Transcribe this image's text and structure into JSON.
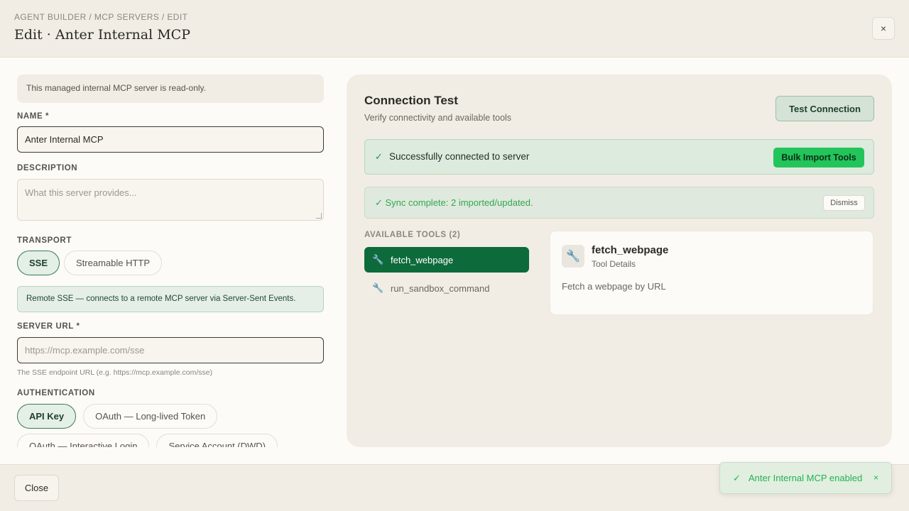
{
  "header": {
    "breadcrumb": "AGENT BUILDER / MCP SERVERS / EDIT",
    "title": "Edit · Anter Internal MCP",
    "close_icon": "×"
  },
  "form": {
    "readonly_note": "This managed internal MCP server is read-only.",
    "name_label": "NAME *",
    "name_value": "Anter Internal MCP",
    "description_label": "DESCRIPTION",
    "description_placeholder": "What this server provides...",
    "transport_label": "TRANSPORT",
    "transport_options": [
      "SSE",
      "Streamable HTTP"
    ],
    "transport_selected": "SSE",
    "transport_info": "Remote SSE — connects to a remote MCP server via Server-Sent Events.",
    "server_url_label": "SERVER URL *",
    "server_url_placeholder": "https://mcp.example.com/sse",
    "server_url_hint": "The SSE endpoint URL (e.g. https://mcp.example.com/sse)",
    "auth_label": "AUTHENTICATION",
    "auth_options": [
      "API Key",
      "OAuth — Long-lived Token",
      "OAuth — Interactive Login",
      "Service Account (DWD)"
    ],
    "auth_selected": "API Key"
  },
  "connection": {
    "title": "Connection Test",
    "subtitle": "Verify connectivity and available tools",
    "test_button": "Test Connection",
    "success_text": "Successfully connected to server",
    "bulk_import_button": "Bulk Import Tools",
    "sync_text": "✓ Sync complete: 2 imported/updated.",
    "dismiss_button": "Dismiss",
    "tools_label": "AVAILABLE TOOLS (2)",
    "tools": [
      "fetch_webpage",
      "run_sandbox_command"
    ],
    "selected_tool": "fetch_webpage",
    "detail": {
      "name": "fetch_webpage",
      "subtitle": "Tool Details",
      "description": "Fetch a webpage by URL"
    }
  },
  "footer": {
    "close_button": "Close"
  },
  "toast": {
    "text": "Anter Internal MCP enabled",
    "close_icon": "×"
  },
  "colors": {
    "accent_green": "#0d6b3b",
    "success_green": "#23c45a",
    "background": "#f1ede4"
  },
  "icons": {
    "tool": "wrench-icon",
    "check": "check-icon"
  }
}
